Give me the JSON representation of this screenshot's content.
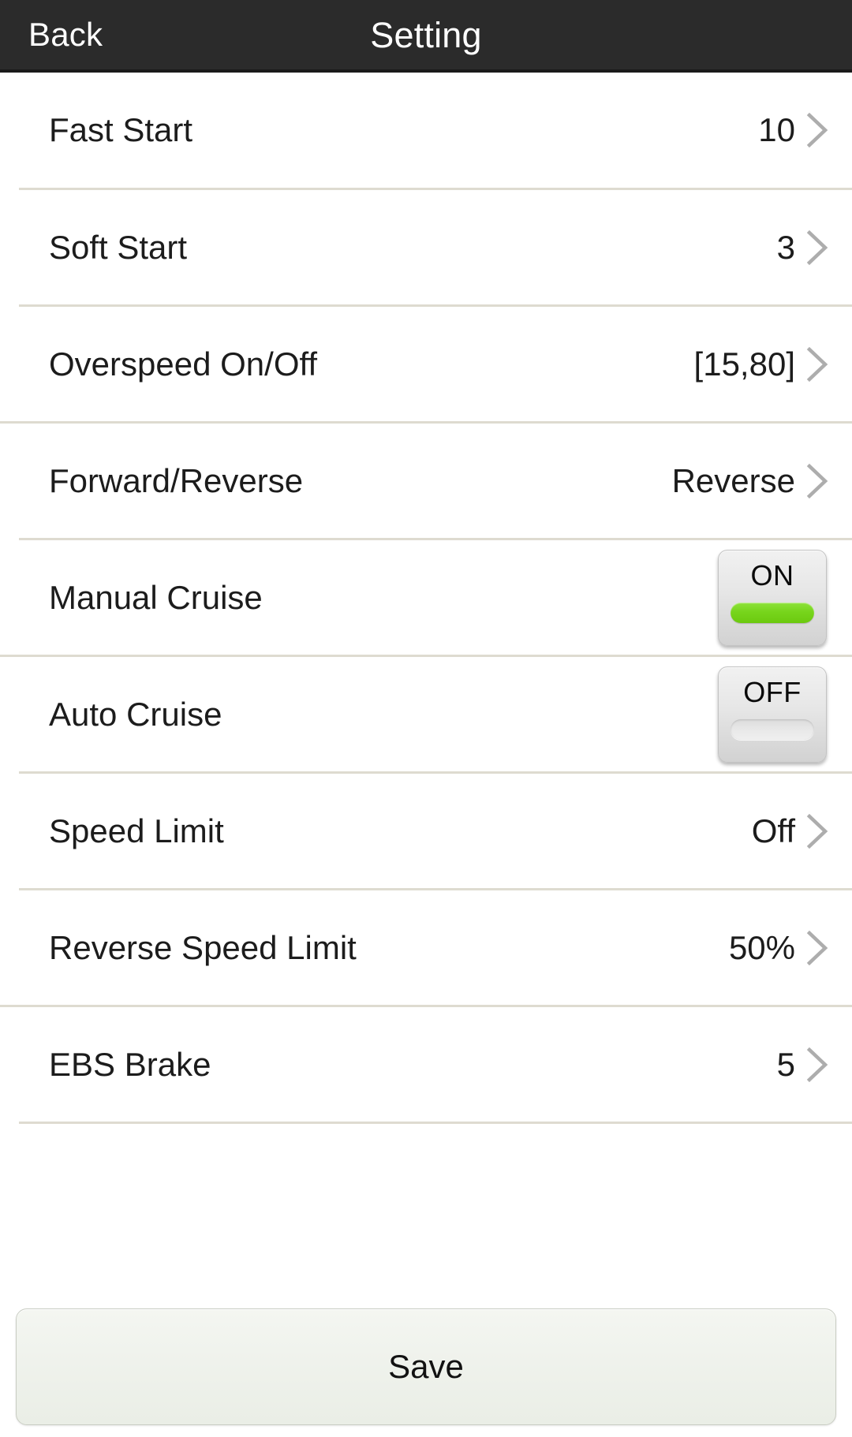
{
  "header": {
    "back_label": "Back",
    "title": "Setting",
    "background_color": "#2b2b2b",
    "text_color": "#ffffff"
  },
  "list": {
    "rows": [
      {
        "label": "Fast Start",
        "value": "10",
        "control": "chevron"
      },
      {
        "label": "Soft Start",
        "value": "3",
        "control": "chevron"
      },
      {
        "label": "Overspeed On/Off",
        "value": "[15,80]",
        "control": "chevron"
      },
      {
        "label": "Forward/Reverse",
        "value": "Reverse",
        "control": "chevron"
      },
      {
        "label": "Manual Cruise",
        "value": "ON",
        "control": "toggle",
        "toggle_state": "on"
      },
      {
        "label": "Auto Cruise",
        "value": "OFF",
        "control": "toggle",
        "toggle_state": "off"
      },
      {
        "label": "Speed Limit",
        "value": "Off",
        "control": "chevron"
      },
      {
        "label": "Reverse Speed Limit",
        "value": "50%",
        "control": "chevron"
      },
      {
        "label": "EBS Brake",
        "value": "5",
        "control": "chevron"
      }
    ]
  },
  "footer": {
    "save_label": "Save"
  },
  "colors": {
    "accent_on": "#77d51c",
    "separator": "#dedbd0",
    "chevron": "#adadad",
    "page_background": "#ffffff"
  },
  "icons": {
    "chevron": "chevron-right-icon"
  }
}
